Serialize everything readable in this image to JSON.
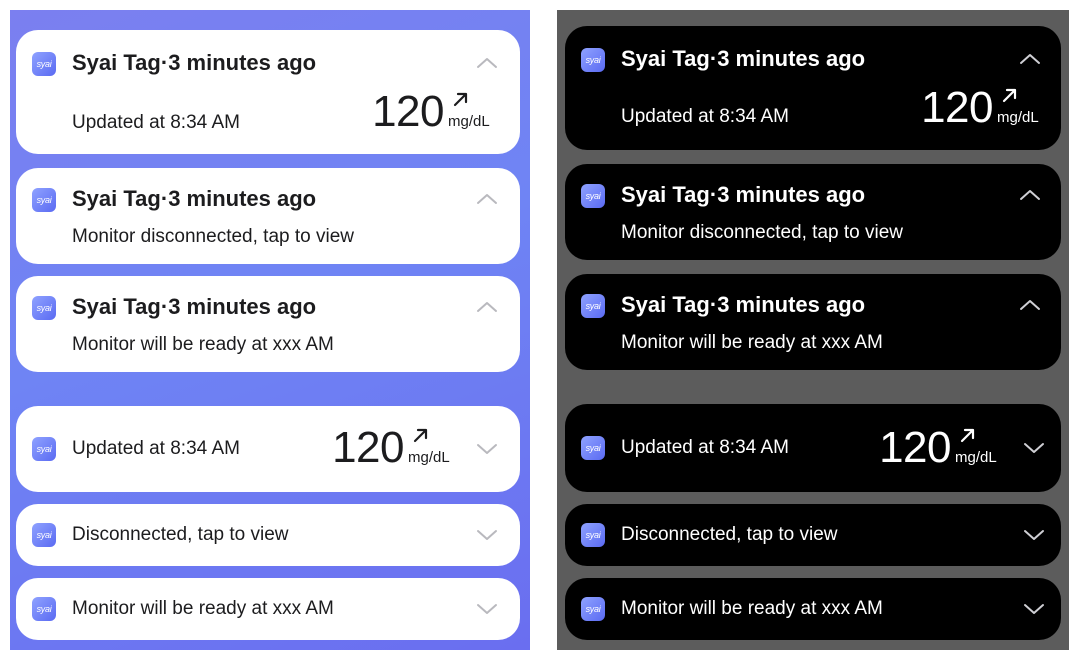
{
  "notifications": {
    "app_name": "Syai Tag",
    "separator": "·",
    "time_ago": "3 minutes ago",
    "icon_label": "syai",
    "expanded": [
      {
        "message": "Updated at 8:34 AM",
        "value": "120",
        "unit": "mg/dL"
      },
      {
        "message": "Monitor disconnected, tap to view"
      },
      {
        "message": "Monitor will be ready at xxx AM"
      }
    ],
    "collapsed": [
      {
        "message": "Updated at 8:34 AM",
        "value": "120",
        "unit": "mg/dL"
      },
      {
        "message": "Disconnected, tap to view"
      },
      {
        "message": "Monitor will be ready at xxx AM"
      }
    ]
  },
  "themes": {
    "light_background": "#7b7ff0",
    "dark_background": "#5c5c5c",
    "light_card": "#ffffff",
    "dark_card": "#000000",
    "icon_accent": "#6a78f5"
  },
  "icons": {
    "expanded_chevron": "chevron-up-icon",
    "collapsed_chevron": "chevron-down-icon",
    "trend": "trend-up-right-arrow-icon",
    "app": "syai-app-icon"
  }
}
